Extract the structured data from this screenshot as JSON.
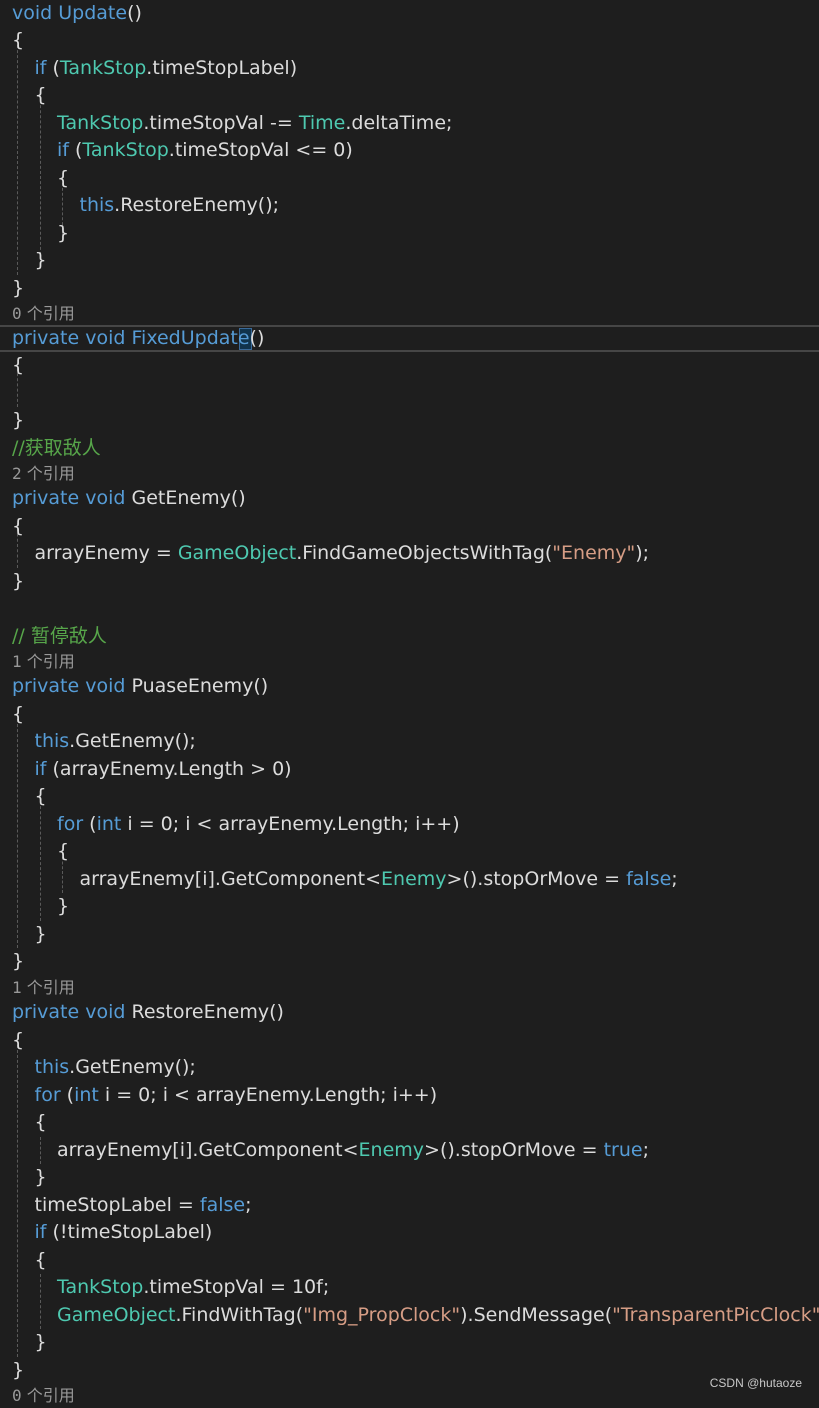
{
  "editor": {
    "lines": [
      [
        {
          "t": "void",
          "c": "kw"
        },
        {
          "t": " "
        },
        {
          "t": "Update",
          "c": "kw"
        },
        {
          "t": "()"
        }
      ],
      [
        {
          "t": "{"
        }
      ],
      [
        {
          "t": "if",
          "c": "kw"
        },
        {
          "t": " ("
        },
        {
          "t": "TankStop",
          "c": "ty"
        },
        {
          "t": ".timeStopLabel)"
        }
      ],
      [
        {
          "t": "{"
        }
      ],
      [
        {
          "t": "TankStop",
          "c": "ty"
        },
        {
          "t": ".timeStopVal "
        },
        {
          "t": "-="
        },
        {
          "t": " "
        },
        {
          "t": "Time",
          "c": "ty"
        },
        {
          "t": ".deltaTime;"
        }
      ],
      [
        {
          "t": "if",
          "c": "kw"
        },
        {
          "t": " ("
        },
        {
          "t": "TankStop",
          "c": "ty"
        },
        {
          "t": ".timeStopVal <= 0)"
        }
      ],
      [
        {
          "t": "{"
        }
      ],
      [
        {
          "t": "this",
          "c": "kw"
        },
        {
          "t": ".RestoreEnemy();"
        }
      ],
      [
        {
          "t": "}"
        }
      ],
      [
        {
          "t": "}"
        }
      ],
      [
        {
          "t": "}"
        }
      ],
      {
        "lens": "0",
        "lens_label": "个引用"
      },
      [
        {
          "t": "private",
          "c": "kw"
        },
        {
          "t": " "
        },
        {
          "t": "void",
          "c": "kw"
        },
        {
          "t": " "
        },
        {
          "t": "FixedUpdate",
          "c": "kw"
        },
        {
          "t": "()"
        }
      ],
      [
        {
          "t": "{"
        }
      ],
      [
        {
          "t": ""
        }
      ],
      [
        {
          "t": "}"
        }
      ],
      [
        {
          "t": "//获取敌人",
          "c": "cm"
        }
      ],
      {
        "lens": "2",
        "lens_label": "个引用"
      },
      [
        {
          "t": "private",
          "c": "kw"
        },
        {
          "t": " "
        },
        {
          "t": "void",
          "c": "kw"
        },
        {
          "t": " GetEnemy()"
        }
      ],
      [
        {
          "t": "{"
        }
      ],
      [
        {
          "t": "arrayEnemy = "
        },
        {
          "t": "GameObject",
          "c": "ty"
        },
        {
          "t": ".FindGameObjectsWithTag("
        },
        {
          "t": "\"Enemy\"",
          "c": "st"
        },
        {
          "t": ");"
        }
      ],
      [
        {
          "t": "}"
        }
      ],
      [
        {
          "t": ""
        }
      ],
      [
        {
          "t": "// 暂停敌人",
          "c": "cm"
        }
      ],
      {
        "lens": "1",
        "lens_label": "个引用"
      },
      [
        {
          "t": "private",
          "c": "kw"
        },
        {
          "t": " "
        },
        {
          "t": "void",
          "c": "kw"
        },
        {
          "t": " PuaseEnemy()"
        }
      ],
      [
        {
          "t": "{"
        }
      ],
      [
        {
          "t": "this",
          "c": "kw"
        },
        {
          "t": ".GetEnemy();"
        }
      ],
      [
        {
          "t": "if",
          "c": "kw"
        },
        {
          "t": " (arrayEnemy.Length > 0)"
        }
      ],
      [
        {
          "t": "{"
        }
      ],
      [
        {
          "t": "for",
          "c": "kw"
        },
        {
          "t": " ("
        },
        {
          "t": "int",
          "c": "kw"
        },
        {
          "t": " i = 0; i < arrayEnemy.Length; i++)"
        }
      ],
      [
        {
          "t": "{"
        }
      ],
      [
        {
          "t": "arrayEnemy[i].GetComponent<"
        },
        {
          "t": "Enemy",
          "c": "ty"
        },
        {
          "t": ">().stopOrMove = "
        },
        {
          "t": "false",
          "c": "kw"
        },
        {
          "t": ";"
        }
      ],
      [
        {
          "t": "}"
        }
      ],
      [
        {
          "t": "}"
        }
      ],
      [
        {
          "t": "}"
        }
      ],
      {
        "lens": "1",
        "lens_label": "个引用"
      },
      [
        {
          "t": "private",
          "c": "kw"
        },
        {
          "t": " "
        },
        {
          "t": "void",
          "c": "kw"
        },
        {
          "t": " RestoreEnemy()"
        }
      ],
      [
        {
          "t": "{"
        }
      ],
      [
        {
          "t": "this",
          "c": "kw"
        },
        {
          "t": ".GetEnemy();"
        }
      ],
      [
        {
          "t": "for",
          "c": "kw"
        },
        {
          "t": " ("
        },
        {
          "t": "int",
          "c": "kw"
        },
        {
          "t": " i = 0; i < arrayEnemy.Length; i++)"
        }
      ],
      [
        {
          "t": "{"
        }
      ],
      [
        {
          "t": "arrayEnemy[i].GetComponent<"
        },
        {
          "t": "Enemy",
          "c": "ty"
        },
        {
          "t": ">().stopOrMove = "
        },
        {
          "t": "true",
          "c": "kw"
        },
        {
          "t": ";"
        }
      ],
      [
        {
          "t": "}"
        }
      ],
      [
        {
          "t": "timeStopLabel = "
        },
        {
          "t": "false",
          "c": "kw"
        },
        {
          "t": ";"
        }
      ],
      [
        {
          "t": "if",
          "c": "kw"
        },
        {
          "t": " (!timeStopLabel)"
        }
      ],
      [
        {
          "t": "{"
        }
      ],
      [
        {
          "t": "TankStop",
          "c": "ty"
        },
        {
          "t": ".timeStopVal = 10f;"
        }
      ],
      [
        {
          "t": "GameObject",
          "c": "ty"
        },
        {
          "t": ".FindWithTag("
        },
        {
          "t": "\"Img_PropClock\"",
          "c": "st"
        },
        {
          "t": ").SendMessage("
        },
        {
          "t": "\"TransparentPicClock\"",
          "c": "st"
        },
        {
          "t": ");  "
        },
        {
          "t": "//",
          "c": "cm"
        }
      ],
      [
        {
          "t": "}"
        }
      ],
      [
        {
          "t": "}"
        }
      ],
      {
        "lens": "0",
        "lens_label": "个引用"
      }
    ]
  },
  "watermark": "CSDN @hutaoze"
}
